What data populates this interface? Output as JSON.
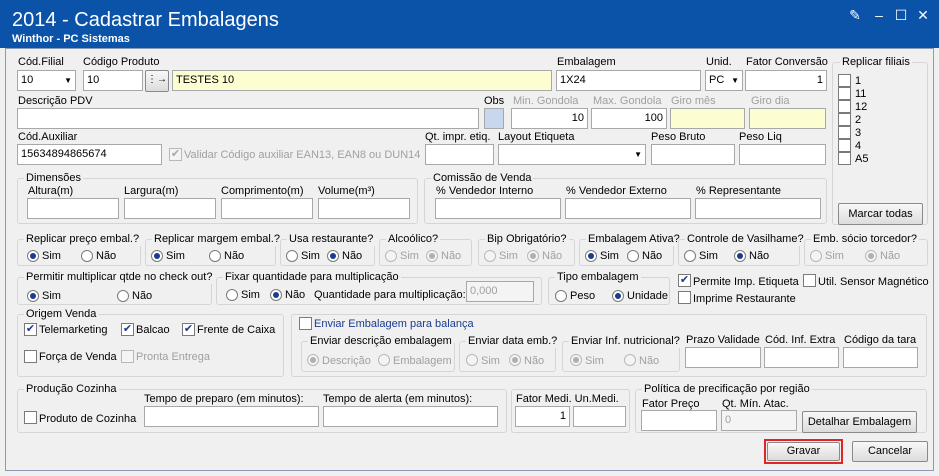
{
  "window": {
    "title": "2014 - Cadastrar Embalagens",
    "subtitle": "Winthor - PC Sistemas"
  },
  "top": {
    "filial_label": "Cód.Filial",
    "filial_value": "10",
    "codprod_label": "Código Produto",
    "codprod_value": "10",
    "descricao_value": "TESTES 10",
    "embalagem_label": "Embalagem",
    "embalagem_value": "1X24",
    "unid_label": "Unid.",
    "unid_value": "PC",
    "fator_label": "Fator Conversão",
    "fator_value": "1",
    "descpdv_label": "Descrição PDV",
    "descpdv_value": "",
    "obs_label": "Obs",
    "min_gondola_label": "Min. Gondola",
    "min_gondola_value": "10",
    "max_gondola_label": "Max. Gondola",
    "max_gondola_value": "100",
    "giro_mes_label": "Giro mês",
    "giro_dia_label": "Giro dia",
    "codaux_label": "Cód.Auxiliar",
    "codaux_value": "15634894865674",
    "validar_label": "Validar Código auxiliar EAN13, EAN8 ou DUN14",
    "qt_etiq_label": "Qt. impr. etiq.",
    "layout_label": "Layout Etiqueta",
    "peso_bruto_label": "Peso Bruto",
    "peso_liq_label": "Peso Liq"
  },
  "replicar": {
    "label": "Replicar filiais",
    "items": [
      "1",
      "11",
      "12",
      "2",
      "3",
      "4",
      "A5"
    ],
    "button": "Marcar todas"
  },
  "dimensoes": {
    "title": "Dimensões",
    "altura": "Altura(m)",
    "largura": "Largura(m)",
    "comprimento": "Comprimento(m)",
    "volume": "Volume(m³)"
  },
  "comissao": {
    "title": "Comissão de Venda",
    "interno": "% Vendedor Interno",
    "externo": "% Vendedor Externo",
    "representante": "% Representante"
  },
  "options": {
    "sim": "Sim",
    "nao": "Não",
    "replicar_preco": "Replicar preço embal.?",
    "replicar_margem": "Replicar margem embal.?",
    "usa_restaurante": "Usa restaurante?",
    "alcoolico": "Alcoólico?",
    "bip": "Bip Obrigatório?",
    "embalagem_ativa": "Embalagem Ativa?",
    "vasilhame": "Controle de Vasilhame?",
    "socio": "Emb. sócio torcedor?",
    "permitir_mult": "Permitir multiplicar qtde no check out?",
    "fixar_qtd": "Fixar quantidade para multiplicação",
    "qtd_mult_label": "Quantidade para multiplicação:",
    "qtd_mult_value": "0,000",
    "tipo_emb": "Tipo embalagem",
    "peso": "Peso",
    "unidade": "Unidade",
    "permite_etiqueta": "Permite Imp. Etiqueta",
    "sensor": "Util. Sensor Magnético",
    "imprime_rest": "Imprime Restaurante"
  },
  "origem": {
    "title": "Origem Venda",
    "telemarketing": "Telemarketing",
    "balcao": "Balcao",
    "frente_caixa": "Frente de Caixa",
    "forca_venda": "Força de Venda",
    "pronta_entrega": "Pronta Entrega"
  },
  "balanca": {
    "enviar": "Enviar Embalagem para balança",
    "enviar_desc": "Enviar descrição embalagem",
    "descricao": "Descrição",
    "embalagem": "Embalagem",
    "enviar_data": "Enviar data emb.?",
    "enviar_nutri": "Enviar Inf. nutricional?",
    "prazo": "Prazo Validade",
    "cod_extra": "Cód. Inf. Extra",
    "cod_tara": "Código da tara"
  },
  "producao": {
    "title": "Produção Cozinha",
    "produto": "Produto de Cozinha",
    "tempo_preparo": "Tempo de preparo (em minutos):",
    "tempo_alerta": "Tempo de alerta (em minutos):"
  },
  "fator_medi": {
    "label": "Fator Medi. Un.Medi.",
    "value": "1"
  },
  "politica": {
    "title": "Política de precificação por região",
    "fator_preco": "Fator Preço",
    "qt_min": "Qt. Mín. Atac.",
    "qt_min_value": "0",
    "detalhar": "Detalhar Embalagem"
  },
  "buttons": {
    "gravar": "Gravar",
    "cancelar": "Cancelar"
  }
}
